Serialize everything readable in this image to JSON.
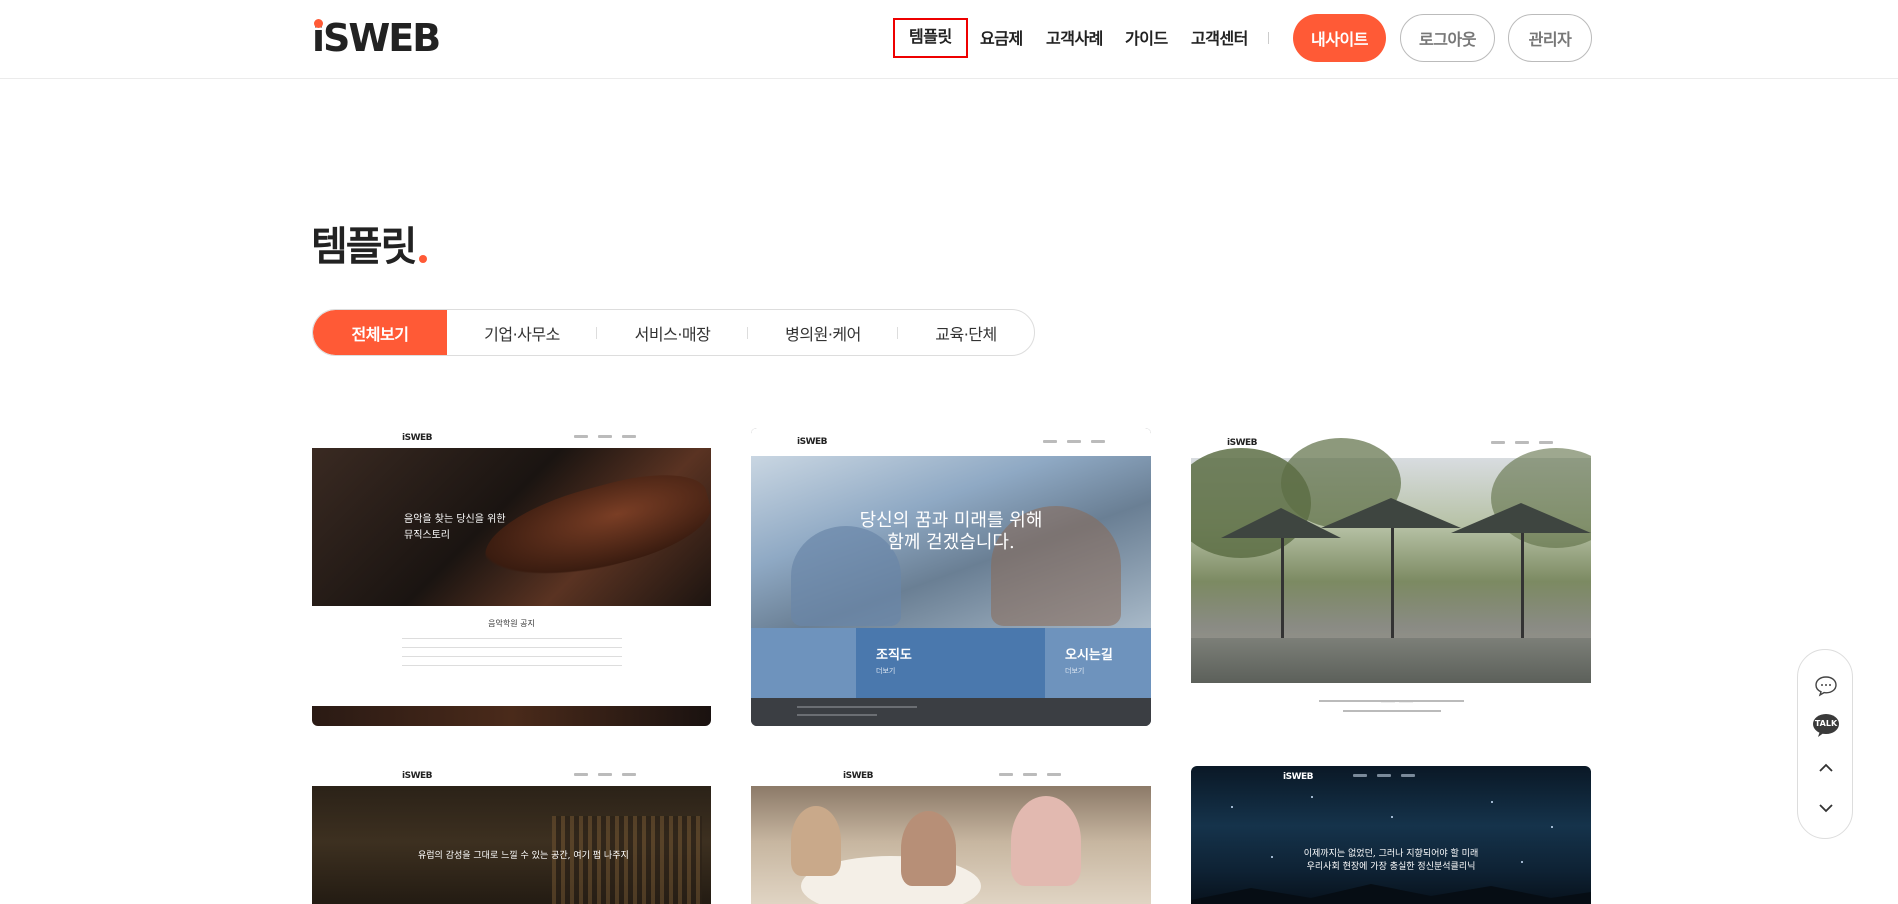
{
  "header": {
    "logo": "iSWEB",
    "nav": [
      {
        "label": "템플릿",
        "active": true
      },
      {
        "label": "요금제"
      },
      {
        "label": "고객사례"
      },
      {
        "label": "가이드"
      },
      {
        "label": "고객센터"
      }
    ],
    "buttons": {
      "mysite": "내사이트",
      "logout": "로그아웃",
      "admin": "관리자"
    }
  },
  "page": {
    "title": "템플릿"
  },
  "tabs": [
    {
      "label": "전체보기",
      "active": true
    },
    {
      "label": "기업·사무소"
    },
    {
      "label": "서비스·매장"
    },
    {
      "label": "병의원·케어"
    },
    {
      "label": "교육·단체"
    }
  ],
  "templates": [
    {
      "logo": "iSWEB",
      "hero_text": [
        "음악을 찾는 당신을 위한",
        "뮤직스토리"
      ],
      "notice_title": "음악학원 공지"
    },
    {
      "logo": "iSWEB",
      "hero_text": [
        "당신의 꿈과 미래를 위해",
        "함께 걷겠습니다."
      ],
      "bands": [
        {
          "label": "조직도",
          "sub": "더보기"
        },
        {
          "label": "오시는길",
          "sub": "더보기"
        }
      ]
    },
    {
      "logo": "iSWEB"
    },
    {
      "logo": "iSWEB",
      "hero_text": [
        "유럽의 감성을 그대로 느낄 수 있는 공간, 여기 펍 나주지"
      ]
    },
    {
      "logo": "iSWEB"
    },
    {
      "logo": "iSWEB",
      "hero_text": [
        "이제까지는 없었던, 그러나 지향되어야 할 미래",
        "우리사회 현장에 가장 충실한 정신분석클리닉"
      ]
    }
  ],
  "quick_menu": {
    "icons": [
      "chat-icon",
      "kakao-talk-icon",
      "chevron-up-icon",
      "chevron-down-icon"
    ],
    "kakao_label": "TALK"
  },
  "colors": {
    "accent": "#ff5a36",
    "active_outline": "#ee0000"
  }
}
